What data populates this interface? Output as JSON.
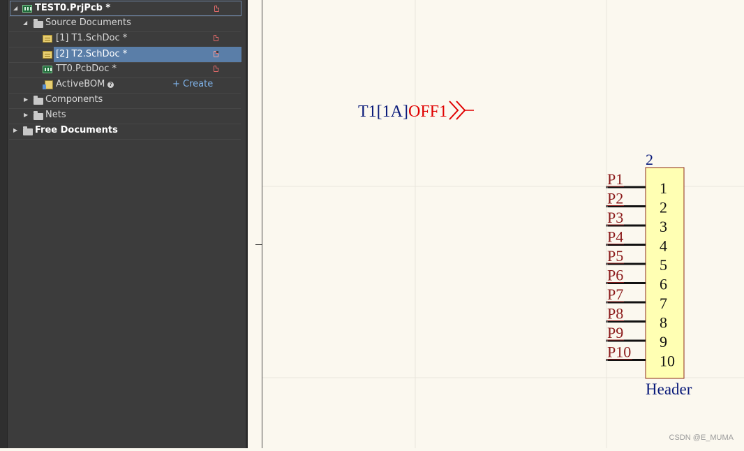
{
  "project_tree": {
    "project": "TEST0.PrjPcb *",
    "source_folder": "Source Documents",
    "documents": [
      {
        "label": "[1] T1.SchDoc *",
        "icon": "schematic-doc-icon",
        "selected": false
      },
      {
        "label": "[2] T2.SchDoc *",
        "icon": "schematic-doc-icon",
        "selected": true
      },
      {
        "label": "TT0.PcbDoc *",
        "icon": "pcb-doc-icon",
        "selected": false
      }
    ],
    "activebom": {
      "label": "ActiveBOM",
      "create_label": "+ Create"
    },
    "folders": [
      "Components",
      "Nets"
    ],
    "free_documents": "Free Documents"
  },
  "schematic": {
    "port": {
      "sheet_ref": "T1[1A]",
      "net": "OFF1"
    },
    "component": {
      "designator": "2",
      "comment": "Header",
      "pin_numbers": [
        "1",
        "2",
        "3",
        "4",
        "5",
        "6",
        "7",
        "8",
        "9",
        "10"
      ],
      "net_labels": [
        "P1",
        "P2",
        "P3",
        "P4",
        "P5",
        "P6",
        "P7",
        "P8",
        "P9",
        "P10"
      ]
    },
    "colors": {
      "net_label": "#8b1a1a",
      "port_text": "#0a1b7a",
      "port_net": "#e00000",
      "body_fill": "#ffffb3",
      "body_stroke": "#8b2a1a",
      "grid": "#e9e6dc"
    }
  },
  "watermark": "CSDN @E_MUMA"
}
